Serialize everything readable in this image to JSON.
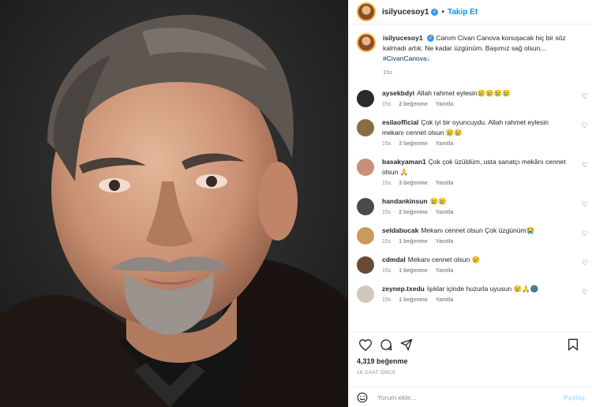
{
  "header": {
    "username": "isilyucesoy1",
    "follow_label": "Takip Et"
  },
  "caption": {
    "username": "isilyucesoy1",
    "text": "Canım Civan Canova konuşacak hiç bir söz kalmadı artık. Ne kadar üzgünüm. Başımız sağ olsun...",
    "hashtag": "#CivanCanova",
    "hashtag_suffix": "↓",
    "time": "15s"
  },
  "comments": [
    {
      "username": "aysekbdyi",
      "text": "Allah rahmet eylesin😢😢😢😢",
      "time": "15s",
      "likes": "2 beğenme",
      "reply": "Yanıtla",
      "avatar_color": "#2a2a2a"
    },
    {
      "username": "esilaofficial",
      "text": "Çok iyi bir oyuncuydu. Allah rahmet eylesin mekanı cennet olsun 😢😢",
      "time": "15s",
      "likes": "3 beğenme",
      "reply": "Yanıtla",
      "avatar_color": "#8b6a44"
    },
    {
      "username": "basakyaman1",
      "text": "Çok çok üzüldüm, usta sanatçı mekânı cennet olsun 🙏",
      "time": "15s",
      "likes": "3 beğenme",
      "reply": "Yanıtla",
      "avatar_color": "#c98f7a"
    },
    {
      "username": "handankinsun",
      "text": "😢😢",
      "time": "15s",
      "likes": "2 beğenme",
      "reply": "Yanıtla",
      "avatar_color": "#4a4a4a"
    },
    {
      "username": "seldabucak",
      "text": "Mekanı cennet olsun Çok üzgünüm😭",
      "time": "15s",
      "likes": "1 beğenme",
      "reply": "Yanıtla",
      "avatar_color": "#c89a5c"
    },
    {
      "username": "cdmdal",
      "text": "Mekanı cennet olsun 😢",
      "time": "15s",
      "likes": "1 beğenme",
      "reply": "Yanıtla",
      "avatar_color": "#6b4a35"
    },
    {
      "username": "zeynep.txedu",
      "text": "Işıklar içinde huzurla uyusun 😢🙏🌚",
      "time": "15s",
      "likes": "1 beğenme",
      "reply": "Yanıtla",
      "avatar_color": "#d1c6bb"
    }
  ],
  "actions": {
    "likes": "4,319 beğenme",
    "posted": "16 SAAT ÖNCE"
  },
  "add_comment": {
    "placeholder": "Yorum ekle...",
    "post_label": "Paylaş"
  },
  "icons": [
    "heart-icon",
    "comment-icon",
    "share-icon",
    "bookmark-icon",
    "emoji-icon",
    "verified-icon"
  ],
  "colors": {
    "follow": "#0095f6",
    "hashtag": "#00376b",
    "post_disabled": "#b2dffc",
    "verified": "#3897f0",
    "story_ring": "#f2b233"
  }
}
